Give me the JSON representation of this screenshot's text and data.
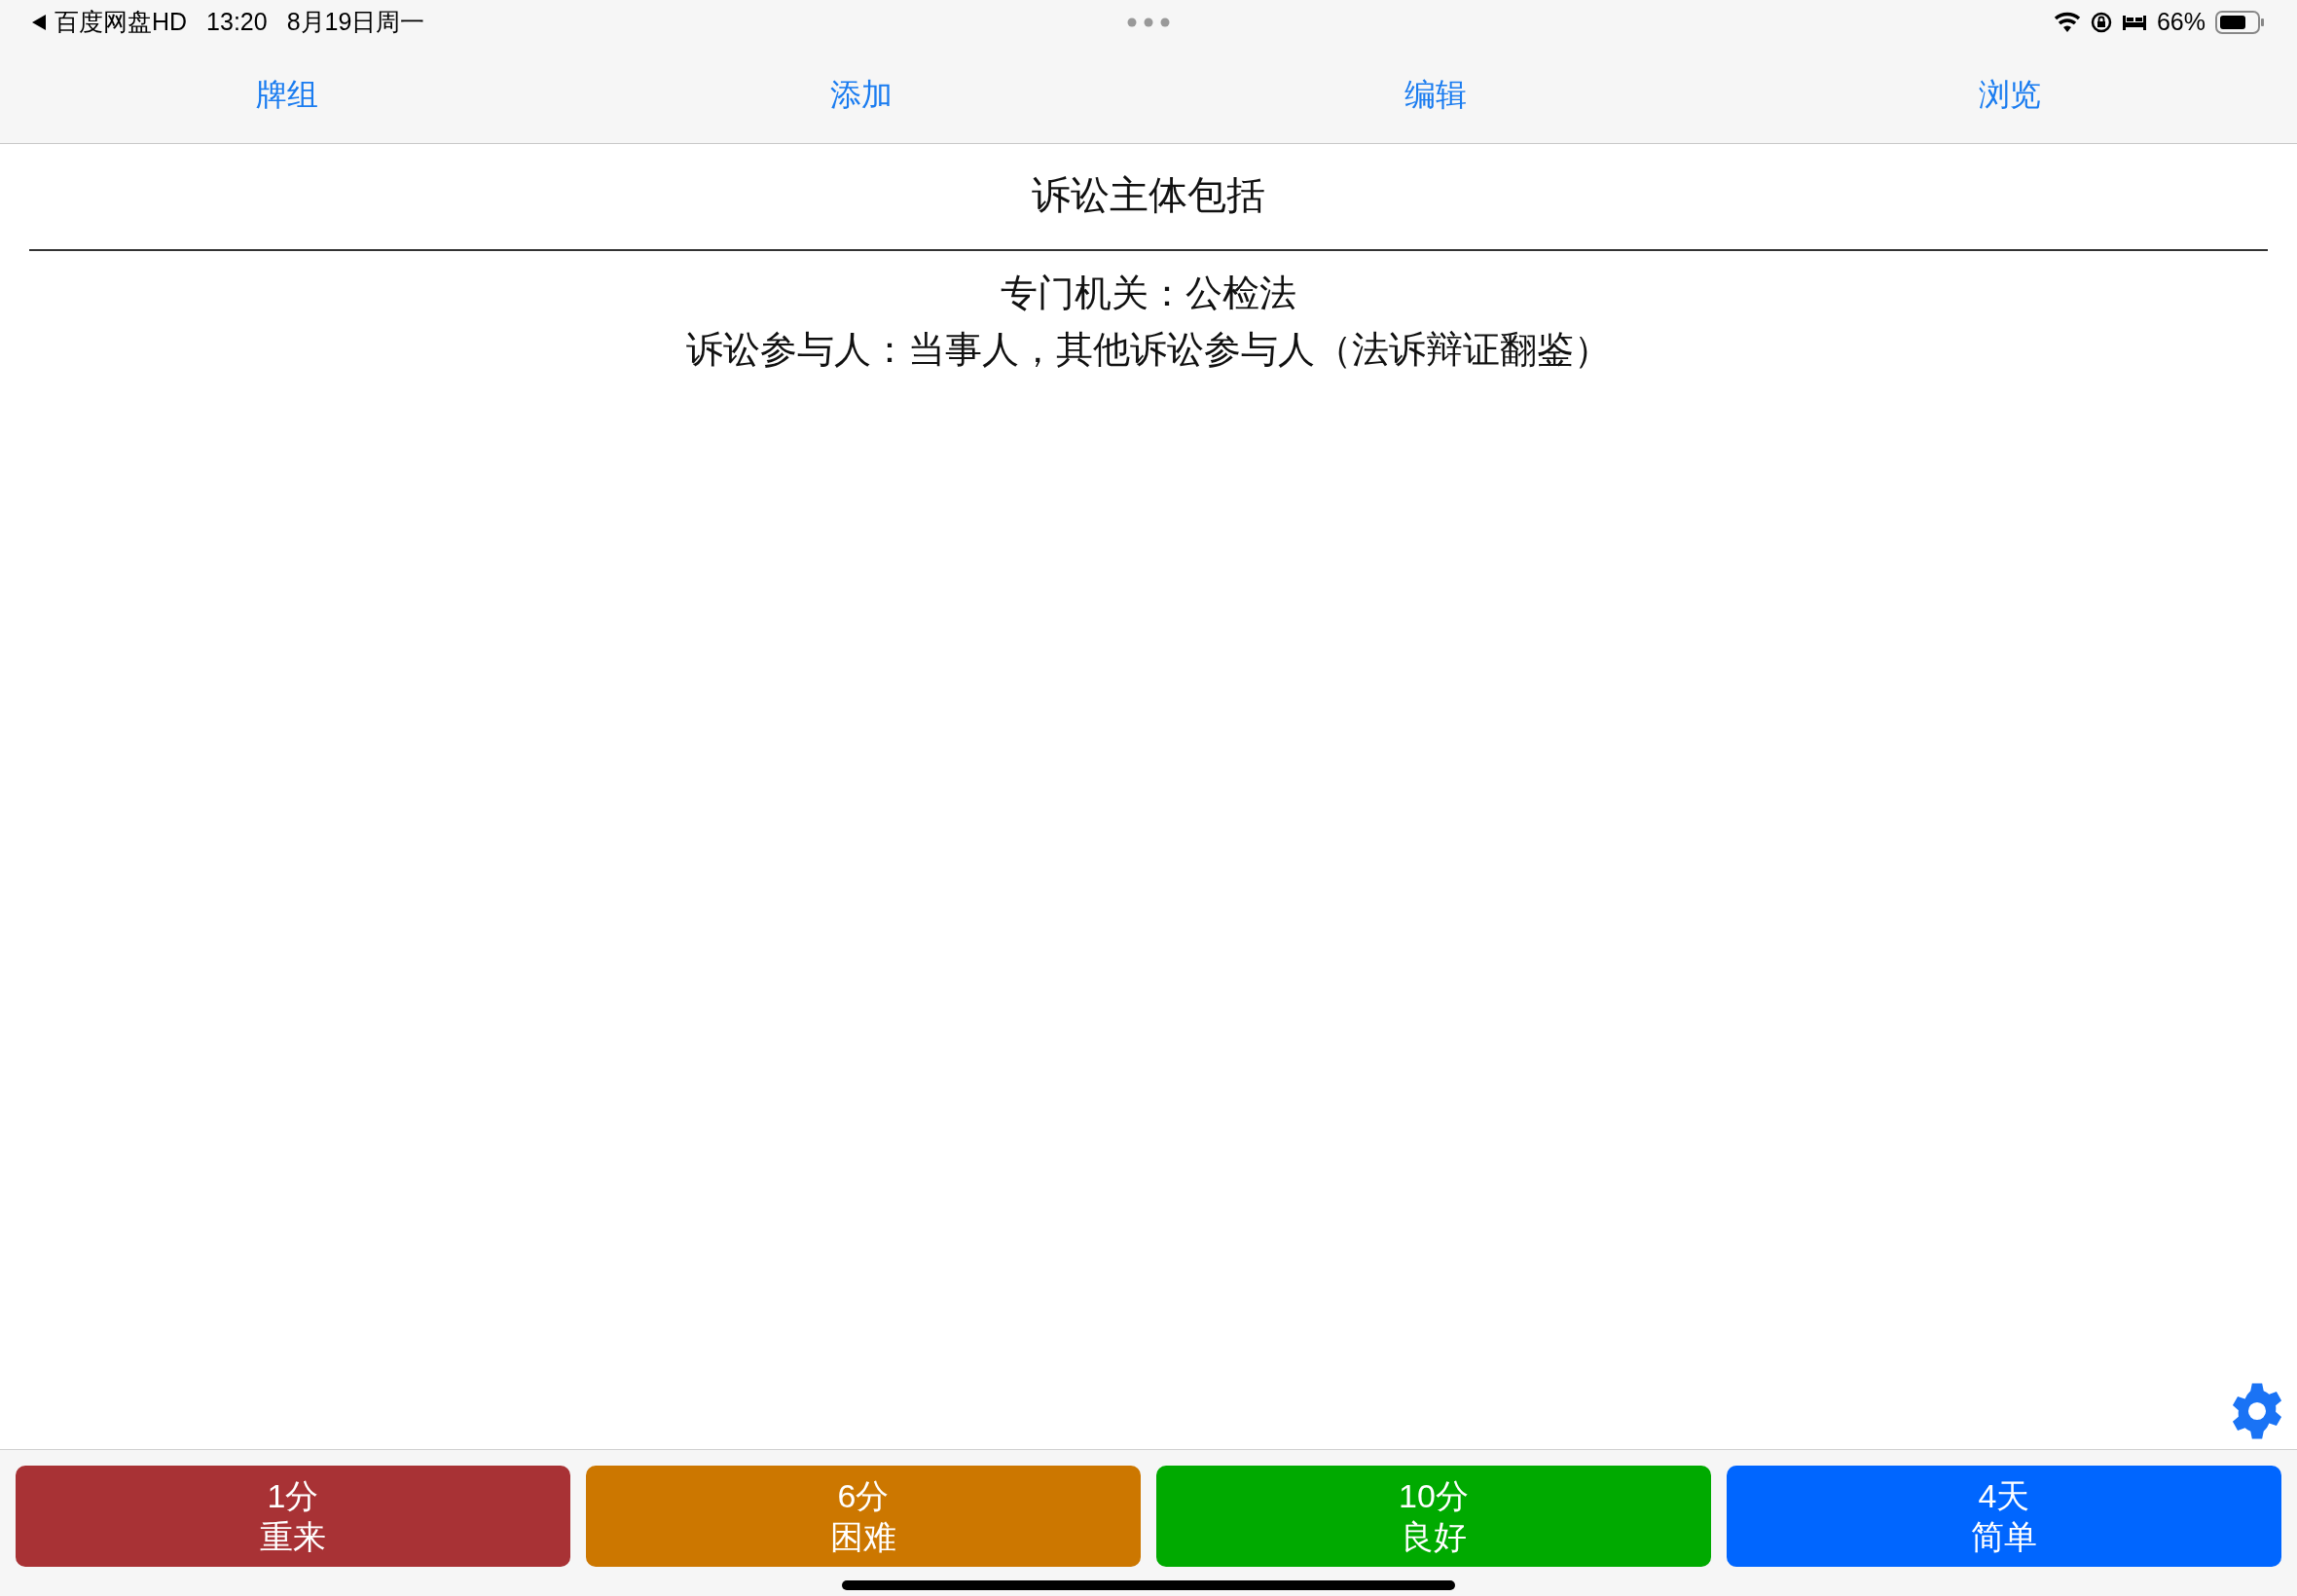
{
  "status_bar": {
    "back_app": "百度网盘HD",
    "time": "13:20",
    "date": "8月19日周一",
    "battery": "66%"
  },
  "tabs": [
    {
      "label": "牌组"
    },
    {
      "label": "添加"
    },
    {
      "label": "编辑"
    },
    {
      "label": "浏览"
    }
  ],
  "card": {
    "question": "诉讼主体包括",
    "answer_lines": [
      "专门机关：公检法",
      "诉讼参与人：当事人，其他诉讼参与人（法诉辩证翻鉴）"
    ]
  },
  "answer_buttons": [
    {
      "interval": "1分",
      "label": "重来",
      "color": "#a83235"
    },
    {
      "interval": "6分",
      "label": "困难",
      "color": "#cc7700"
    },
    {
      "interval": "10分",
      "label": "良好",
      "color": "#00aa00"
    },
    {
      "interval": "4天",
      "label": "简单",
      "color": "#0066ff"
    }
  ]
}
